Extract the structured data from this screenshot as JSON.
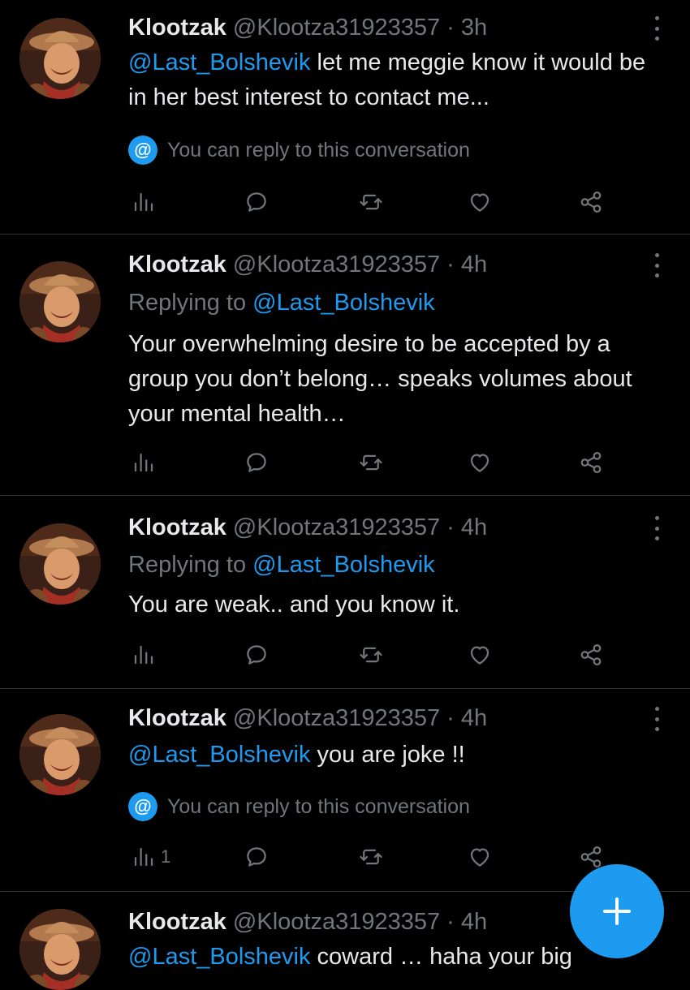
{
  "tweets": [
    {
      "name": "Klootzak",
      "handle": "@Klootza31923357",
      "dot": "·",
      "time": "3h",
      "mention": "@Last_Bolshevik",
      "text": " let me meggie know it would be in her best interest to contact me...",
      "notice": "You can reply to this conversation",
      "views": ""
    },
    {
      "name": "Klootzak",
      "handle": "@Klootza31923357",
      "dot": "·",
      "time": "4h",
      "replying_prefix": "Replying to ",
      "replying_to": "@Last_Bolshevik",
      "text": "Your overwhelming desire to be accepted by a group you don’t belong… speaks volumes about your mental health…",
      "views": ""
    },
    {
      "name": "Klootzak",
      "handle": "@Klootza31923357",
      "dot": "·",
      "time": "4h",
      "replying_prefix": "Replying to ",
      "replying_to": "@Last_Bolshevik",
      "text": "You are weak.. and you know it.",
      "views": ""
    },
    {
      "name": "Klootzak",
      "handle": "@Klootza31923357",
      "dot": "·",
      "time": "4h",
      "mention": "@Last_Bolshevik",
      "text": " you are joke !!",
      "notice": "You can reply to this conversation",
      "views": "1"
    },
    {
      "name": "Klootzak",
      "handle": "@Klootza31923357",
      "dot": "·",
      "time": "4h",
      "mention": "@Last_Bolshevik",
      "text": " coward … haha your big"
    }
  ],
  "notice_badge": "@",
  "colors": {
    "background": "#000000",
    "accent": "#1d9bf0",
    "muted": "#71767b",
    "text": "#e7e9ea",
    "divider": "#2f3336"
  },
  "icons": {
    "views": "analytics-icon",
    "reply": "reply-icon",
    "retweet": "retweet-icon",
    "like": "heart-icon",
    "share": "share-icon",
    "more": "more-vertical-icon",
    "compose": "plus-icon"
  }
}
